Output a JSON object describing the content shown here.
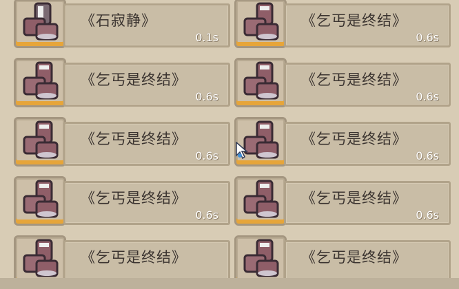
{
  "items": [
    {
      "name": "《石寂静》",
      "time": "0.1s",
      "icon": "boots-icon"
    },
    {
      "name": "《乞丐是终结》",
      "time": "0.6s",
      "icon": "boots-icon"
    },
    {
      "name": "《乞丐是终结》",
      "time": "0.6s",
      "icon": "boots-icon"
    },
    {
      "name": "《乞丐是终结》",
      "time": "0.6s",
      "icon": "boots-icon"
    },
    {
      "name": "《乞丐是终结》",
      "time": "0.6s",
      "icon": "boots-icon"
    },
    {
      "name": "《乞丐是终结》",
      "time": "0.6s",
      "icon": "boots-icon"
    },
    {
      "name": "《乞丐是终结》",
      "time": "0.6s",
      "icon": "boots-icon"
    },
    {
      "name": "《乞丐是终结》",
      "time": "0.6s",
      "icon": "boots-icon"
    },
    {
      "name": "《乞丐是终结》",
      "time": "",
      "icon": "boots-icon"
    },
    {
      "name": "《乞丐是终结》",
      "time": "",
      "icon": "boots-icon"
    }
  ],
  "colors": {
    "background": "#d8ccb5",
    "tile_accent": "#e6a53a",
    "time_text": "#ffffff"
  }
}
